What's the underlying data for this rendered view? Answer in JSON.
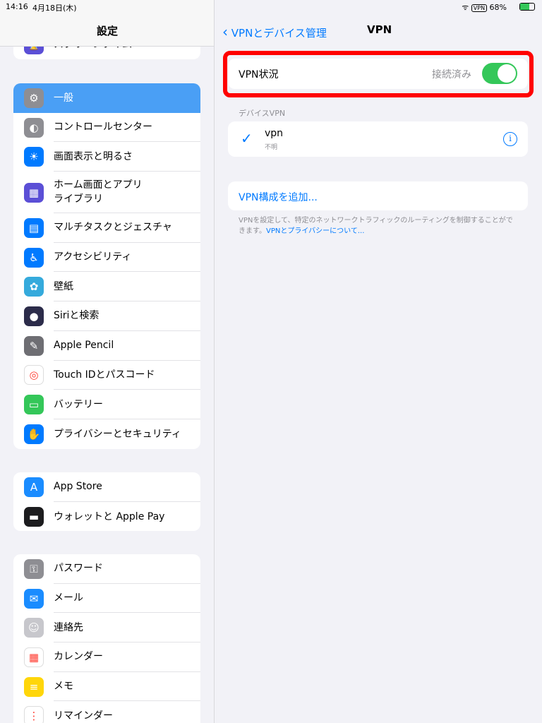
{
  "status": {
    "time": "14:16",
    "date": "4月18日(木)",
    "vpn": "VPN",
    "battery": "68%"
  },
  "sidebar": {
    "title": "設定",
    "partial_item": "スクリーンタイム",
    "groups": [
      [
        {
          "label": "一般",
          "icon": "gear-icon",
          "color": "#8e8e93",
          "glyph": "⚙",
          "selected": true
        },
        {
          "label": "コントロールセンター",
          "icon": "switches-icon",
          "color": "#8e8e93",
          "glyph": "◐"
        },
        {
          "label": "画面表示と明るさ",
          "icon": "sun-icon",
          "color": "#007aff",
          "glyph": "☀"
        },
        {
          "label": "ホーム画面とアプリ\nライブラリ",
          "icon": "home-grid-icon",
          "color": "#5b4fd6",
          "glyph": "▦",
          "tall": true
        },
        {
          "label": "マルチタスクとジェスチャ",
          "icon": "multitask-icon",
          "color": "#007aff",
          "glyph": "▤"
        },
        {
          "label": "アクセシビリティ",
          "icon": "accessibility-icon",
          "color": "#007aff",
          "glyph": "♿"
        },
        {
          "label": "壁紙",
          "icon": "flower-icon",
          "color": "#35aadc",
          "glyph": "✿"
        },
        {
          "label": "Siriと検索",
          "icon": "siri-icon",
          "color": "#2c2c4a",
          "glyph": "●"
        },
        {
          "label": "Apple Pencil",
          "icon": "pencil-icon",
          "color": "#6e6e73",
          "glyph": "✎"
        },
        {
          "label": "Touch IDとパスコード",
          "icon": "fingerprint-icon",
          "color": "#ffffff",
          "glyph": "◎",
          "fg": "#ff3b30"
        },
        {
          "label": "バッテリー",
          "icon": "battery-icon",
          "color": "#34c759",
          "glyph": "▭"
        },
        {
          "label": "プライバシーとセキュリティ",
          "icon": "hand-icon",
          "color": "#007aff",
          "glyph": "✋"
        }
      ],
      [
        {
          "label": "App Store",
          "icon": "app-store-icon",
          "color": "#1a8cff",
          "glyph": "A"
        },
        {
          "label": "ウォレットと Apple Pay",
          "icon": "wallet-icon",
          "color": "#1c1c1e",
          "glyph": "▬"
        }
      ],
      [
        {
          "label": "パスワード",
          "icon": "key-icon",
          "color": "#8e8e93",
          "glyph": "⚿"
        },
        {
          "label": "メール",
          "icon": "mail-icon",
          "color": "#1a8cff",
          "glyph": "✉"
        },
        {
          "label": "連絡先",
          "icon": "contacts-icon",
          "color": "#c7c7cc",
          "glyph": "☺"
        },
        {
          "label": "カレンダー",
          "icon": "calendar-icon",
          "color": "#ffffff",
          "glyph": "▦",
          "fg": "#ff3b30"
        },
        {
          "label": "メモ",
          "icon": "notes-icon",
          "color": "#ffd60a",
          "glyph": "≡",
          "fg": "#fff"
        },
        {
          "label": "リマインダー",
          "icon": "reminders-icon",
          "color": "#ffffff",
          "glyph": "⋮",
          "fg": "#ff3b30"
        }
      ]
    ]
  },
  "main": {
    "back_label": "VPNとデバイス管理",
    "title": "VPN",
    "vpn_status_label": "VPN状況",
    "vpn_status_value": "接続済み",
    "vpn_toggle_on": true,
    "section_header": "デバイスVPN",
    "vpn_name": "vpn",
    "vpn_sub": "不明",
    "add_config": "VPN構成を追加...",
    "footer_text": "VPNを設定して、特定のネットワークトラフィックのルーティングを制御することができます。",
    "footer_link": "VPNとプライバシーについて..."
  },
  "colors": {
    "accent": "#007aff",
    "toggle": "#34c759",
    "highlight": "#ff0000"
  }
}
